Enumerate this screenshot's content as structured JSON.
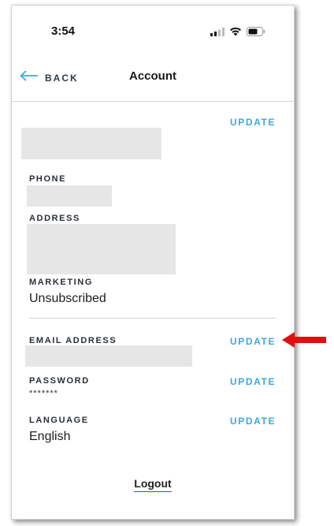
{
  "status_bar": {
    "time": "3:54"
  },
  "nav": {
    "back_label": "BACK",
    "title": "Account"
  },
  "fields": {
    "update_label": "UPDATE",
    "phone_label": "PHONE",
    "address_label": "ADDRESS",
    "marketing_label": "MARKETING",
    "marketing_value": "Unsubscribed",
    "email_label": "EMAIL ADDRESS",
    "password_label": "PASSWORD",
    "password_value": "*******",
    "language_label": "LANGUAGE",
    "language_value": "English"
  },
  "footer": {
    "logout_label": "Logout"
  },
  "colors": {
    "accent": "#3aa8e0",
    "annotation_arrow": "#e01010",
    "redaction": "#e6e6e6"
  },
  "icons": {
    "back": "arrow-left-icon",
    "signal": "signal-icon",
    "wifi": "wifi-icon",
    "battery": "battery-icon",
    "annotation": "red-arrow-icon"
  }
}
